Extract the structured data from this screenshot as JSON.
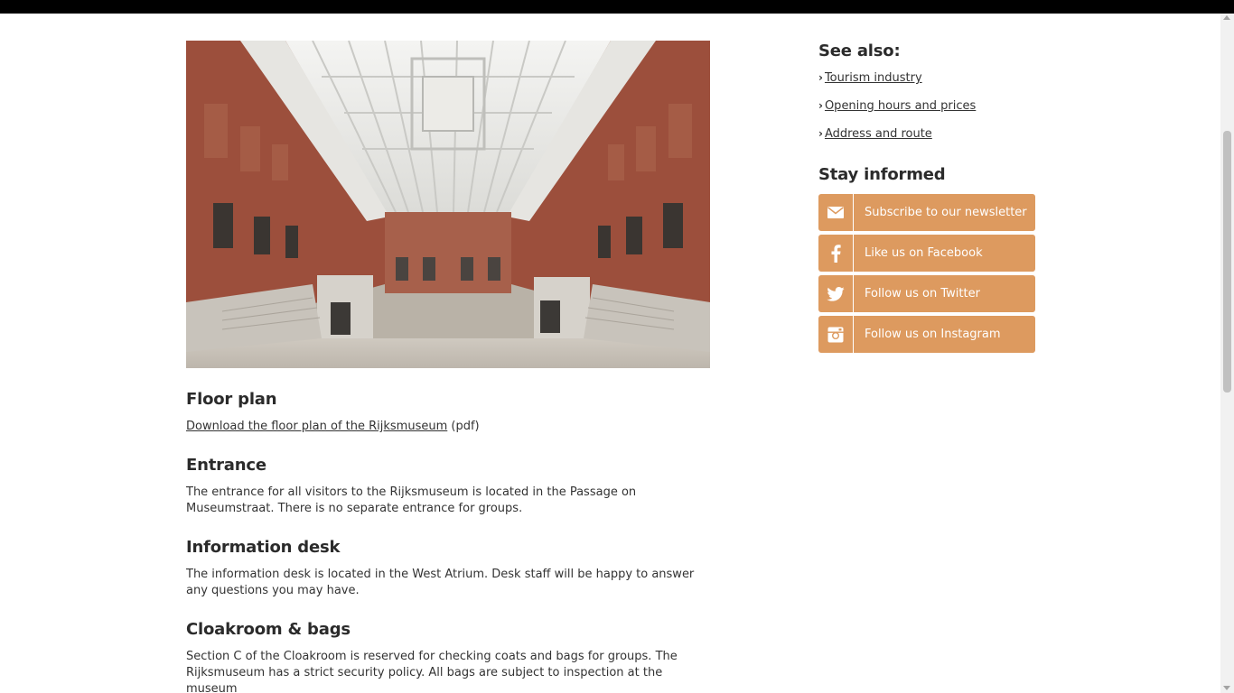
{
  "colors": {
    "accent": "#dd9a5f",
    "text": "#333333",
    "heading": "#2b2b2b",
    "topbar": "#000000"
  },
  "hero_image": {
    "icon": "museum-atrium-photo"
  },
  "main": {
    "floor_plan": {
      "heading": "Floor plan",
      "link_text": "Download the floor plan of the Rijksmuseum",
      "suffix": " (pdf)"
    },
    "entrance": {
      "heading": "Entrance",
      "text": "The entrance for all visitors to the Rijksmuseum is located in the Passage on Museumstraat. There is no separate entrance for groups."
    },
    "information_desk": {
      "heading": "Information desk",
      "text": "The information desk is located in the West Atrium. Desk staff will be happy to answer any questions you may have."
    },
    "cloakroom": {
      "heading": "Cloakroom & bags",
      "text": "Section C of the Cloakroom is reserved for checking coats and bags for groups. The Rijksmuseum has a strict security policy. All bags are subject to inspection at the museum"
    }
  },
  "sidebar": {
    "see_also": {
      "heading": "See also:",
      "links": [
        {
          "label": "Tourism industry"
        },
        {
          "label": "Opening hours and prices"
        },
        {
          "label": "Address and route"
        }
      ]
    },
    "stay_informed": {
      "heading": "Stay informed",
      "buttons": [
        {
          "label": "Subscribe to our newsletter",
          "icon": "envelope-icon"
        },
        {
          "label": "Like us on Facebook",
          "icon": "facebook-icon"
        },
        {
          "label": "Follow us on Twitter",
          "icon": "twitter-icon"
        },
        {
          "label": "Follow us on Instagram",
          "icon": "instagram-icon"
        }
      ]
    }
  }
}
